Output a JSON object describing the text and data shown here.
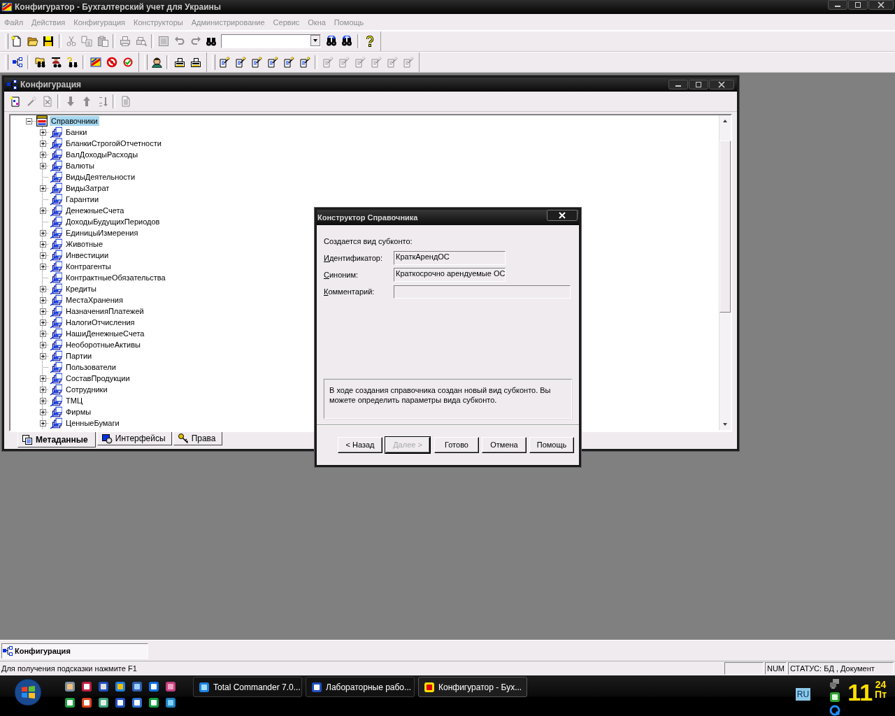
{
  "window": {
    "title": "Конфигуратор - Бухгалтерский учет для Украины"
  },
  "menu": [
    {
      "label": "Файл",
      "disabled": true
    },
    {
      "label": "Действия",
      "disabled": true
    },
    {
      "label": "Конфигурация",
      "disabled": true
    },
    {
      "label": "Конструкторы",
      "disabled": true
    },
    {
      "label": "Администрирование",
      "disabled": true
    },
    {
      "label": "Сервис",
      "disabled": true
    },
    {
      "label": "Окна",
      "disabled": true
    },
    {
      "label": "Помощь",
      "disabled": true
    }
  ],
  "toolbar_1": [
    {
      "disabled": false
    },
    {
      "disabled": false
    },
    {
      "disabled": false
    },
    {
      "disabled": true
    },
    {
      "disabled": true
    },
    {
      "disabled": true
    },
    {
      "disabled": true
    },
    {
      "disabled": true
    },
    {
      "disabled": true
    },
    {
      "disabled": true
    },
    {
      "disabled": true
    },
    {
      "disabled": false
    },
    {
      "disabled": false
    },
    {
      "disabled": false
    },
    {
      "disabled": false
    }
  ],
  "toolbar_2": [
    {
      "disabled": false
    },
    {
      "disabled": false
    },
    {
      "disabled": false
    },
    {
      "disabled": false
    },
    {
      "disabled": false
    },
    {
      "disabled": false
    },
    {
      "disabled": false
    },
    {
      "disabled": false
    },
    {
      "disabled": false
    },
    {
      "disabled": false
    },
    {
      "disabled": false
    },
    {
      "disabled": false
    },
    {
      "disabled": false
    },
    {
      "disabled": false
    },
    {
      "disabled": false
    },
    {
      "disabled": false
    },
    {
      "disabled": true
    },
    {
      "disabled": true
    },
    {
      "disabled": true
    },
    {
      "disabled": true
    },
    {
      "disabled": true
    },
    {
      "disabled": true
    }
  ],
  "config_window": {
    "title": "Конфигурация",
    "toolbar": [
      {
        "disabled": false
      },
      {
        "disabled": true
      },
      {
        "disabled": true
      },
      {
        "disabled": true
      },
      {
        "disabled": true
      },
      {
        "disabled": true
      },
      {
        "disabled": true
      }
    ],
    "tree": {
      "label": "Справочники",
      "selected": true,
      "expanded": true,
      "children": [
        {
          "label": "Банки",
          "selected": false,
          "expandable": true
        },
        {
          "label": "БланкиСтрогойОтчетности",
          "selected": false,
          "expandable": true
        },
        {
          "label": "ВалДоходыРасходы",
          "selected": false,
          "expandable": true
        },
        {
          "label": "Валюты",
          "selected": false,
          "expandable": true
        },
        {
          "label": "ВидыДеятельности",
          "selected": false,
          "expandable": false
        },
        {
          "label": "ВидыЗатрат",
          "selected": false,
          "expandable": true
        },
        {
          "label": "Гарантии",
          "selected": false,
          "expandable": false
        },
        {
          "label": "ДенежныеСчета",
          "selected": false,
          "expandable": true
        },
        {
          "label": "ДоходыБудущихПериодов",
          "selected": false,
          "expandable": false
        },
        {
          "label": "ЕдиницыИзмерения",
          "selected": false,
          "expandable": true
        },
        {
          "label": "Животные",
          "selected": false,
          "expandable": true
        },
        {
          "label": "Инвестиции",
          "selected": false,
          "expandable": true
        },
        {
          "label": "Контрагенты",
          "selected": false,
          "expandable": true
        },
        {
          "label": "КонтрактныеОбязательства",
          "selected": false,
          "expandable": false
        },
        {
          "label": "Кредиты",
          "selected": false,
          "expandable": true
        },
        {
          "label": "МестаХранения",
          "selected": false,
          "expandable": true
        },
        {
          "label": "НазначенияПлатежей",
          "selected": false,
          "expandable": true
        },
        {
          "label": "НалогиОтчисления",
          "selected": false,
          "expandable": true
        },
        {
          "label": "НашиДенежныеСчета",
          "selected": false,
          "expandable": true
        },
        {
          "label": "НеоборотныеАктивы",
          "selected": false,
          "expandable": true
        },
        {
          "label": "Партии",
          "selected": false,
          "expandable": true
        },
        {
          "label": "Пользователи",
          "selected": false,
          "expandable": false
        },
        {
          "label": "СоставПродукции",
          "selected": false,
          "expandable": true
        },
        {
          "label": "Сотрудники",
          "selected": false,
          "expandable": true
        },
        {
          "label": "ТМЦ",
          "selected": false,
          "expandable": true
        },
        {
          "label": "Фирмы",
          "selected": false,
          "expandable": true
        },
        {
          "label": "ЦенныеБумаги",
          "selected": false,
          "expandable": true
        }
      ]
    },
    "tabs": [
      {
        "label": "Метаданные",
        "selected": true
      },
      {
        "label": "Интерфейсы",
        "selected": false
      },
      {
        "label": "Права",
        "selected": false
      }
    ]
  },
  "dialog": {
    "title": "Конструктор Справочника",
    "heading": "Создается вид субконто:",
    "fields": [
      {
        "label": "Идентификатор:",
        "value": "КраткАрендОС",
        "disabled": true
      },
      {
        "label": "Синоним:",
        "value": "Краткосрочно арендуемые ОС",
        "disabled": true
      },
      {
        "label": "Комментарий:",
        "disabled": true
      }
    ],
    "info": "В ходе создания справочника создан новый вид субконто. Вы можете определить параметры вида субконто.",
    "buttons": [
      {
        "label": "< Назад",
        "disabled": false
      },
      {
        "label": "Далее >",
        "disabled": true
      },
      {
        "label": "Готово",
        "disabled": false
      },
      {
        "label": "Отмена",
        "disabled": false
      },
      {
        "label": "Помощь",
        "disabled": false
      }
    ]
  },
  "window_tabs": [
    {
      "label": "Конфигурация",
      "selected": true
    }
  ],
  "status_bar": {
    "hint": "Для получения подсказки нажмите F1",
    "panels": [
      "NUM",
      "СТАТУС: БД , Документ"
    ]
  },
  "taskbar": {
    "tasks": [
      {
        "label": "Total Commander 7.0...",
        "selected": false
      },
      {
        "label": "Лабораторные рабо...",
        "selected": false
      },
      {
        "label": "Конфигуратор - Бух...",
        "selected": true
      }
    ],
    "language": "RU",
    "clock": {
      "hour": "11",
      "minute": "24",
      "day": "Пт"
    }
  }
}
